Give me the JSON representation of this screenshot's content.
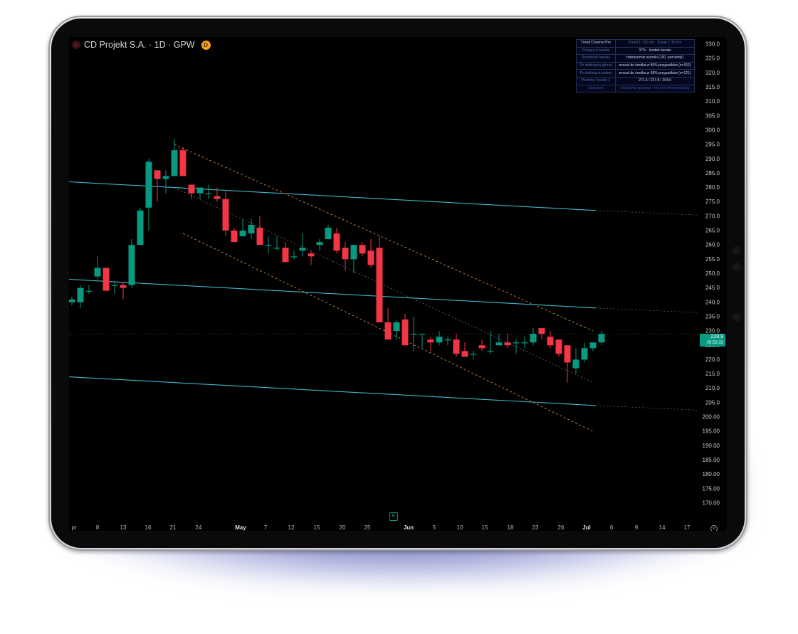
{
  "symbol": {
    "title": "CD Projekt S.A. · 1D · GPW",
    "badge": "D",
    "logo_glyph": "r"
  },
  "info_table": {
    "rows": [
      {
        "k": "Trend Channel Pro",
        "v": "Kanał 1: 100 dni · Kanał 2: 50 dni"
      },
      {
        "k": "Pozycja w kanale",
        "v": "37% · środek kanału"
      },
      {
        "k": "Szerokość kanału",
        "v": "historycznie szeroki (100. percentyl)"
      },
      {
        "k": "Po dotknięciu górnej",
        "v": "wracał do środka w 80% przypadków (n=152)"
      },
      {
        "k": "Po dotknięciu dolnej",
        "v": "wracał do środka w 58% przypadków (n=121)"
      },
      {
        "k": "Poziomy Kanału 1",
        "v": "271.6 / 237.8 / 204.0"
      },
      {
        "k": "Statystyki",
        "v": "statystyka opisowa – nie jest rekomendacją"
      }
    ]
  },
  "price_scale": {
    "labels": [
      "330.0",
      "325.0",
      "320.0",
      "315.0",
      "310.0",
      "305.0",
      "300.0",
      "295.0",
      "290.0",
      "285.0",
      "280.0",
      "275.0",
      "270.0",
      "265.0",
      "260.0",
      "255.0",
      "250.0",
      "245.0",
      "240.0",
      "235.0",
      "230.0",
      "225.0",
      "220.0",
      "215.0",
      "210.0",
      "205.0",
      "200.00",
      "195.00",
      "190.00",
      "185.00",
      "180.00",
      "175.00",
      "170.00"
    ],
    "current_price": "228.9",
    "countdown": "05:53:33"
  },
  "time_axis": {
    "labels": [
      "pr",
      "8",
      "13",
      "16",
      "21",
      "24",
      "May",
      "7",
      "12",
      "15",
      "20",
      "25",
      "Jun",
      "5",
      "10",
      "15",
      "18",
      "23",
      "26",
      "Jul",
      "6",
      "9",
      "14",
      "17"
    ]
  },
  "colors": {
    "up": "#089981",
    "down": "#f23645",
    "channel_cyan": "#3fb6c8",
    "channel_orange": "#d98a3a",
    "grid_dot": "#4a4a4a"
  },
  "chart_data": {
    "type": "candlestick",
    "interval": "1D",
    "ylim": [
      168,
      331
    ],
    "x": [
      "Apr 3",
      "Apr 4",
      "Apr 7",
      "Apr 8",
      "Apr 9",
      "Apr 10",
      "Apr 11",
      "Apr 14",
      "Apr 15",
      "Apr 16",
      "Apr 17",
      "Apr 18",
      "Apr 22",
      "Apr 23",
      "Apr 24",
      "Apr 25",
      "Apr 28",
      "Apr 29",
      "Apr 30",
      "May 2",
      "May 5",
      "May 6",
      "May 7",
      "May 8",
      "May 9",
      "May 12",
      "May 13",
      "May 14",
      "May 15",
      "May 16",
      "May 19",
      "May 20",
      "May 21",
      "May 22",
      "May 23",
      "May 26",
      "May 27",
      "May 28",
      "May 29",
      "May 30",
      "Jun 2",
      "Jun 3",
      "Jun 4",
      "Jun 5",
      "Jun 6",
      "Jun 9",
      "Jun 10",
      "Jun 11",
      "Jun 12",
      "Jun 13",
      "Jun 16",
      "Jun 17",
      "Jun 18",
      "Jun 19",
      "Jun 20",
      "Jun 23",
      "Jun 24",
      "Jun 25",
      "Jun 26",
      "Jun 27",
      "Jun 30",
      "Jul 1",
      "Jul 2"
    ],
    "ohlc": [
      [
        240,
        242,
        239,
        241
      ],
      [
        240,
        246,
        238,
        245
      ],
      [
        244,
        246,
        243,
        244
      ],
      [
        249,
        256,
        248,
        252
      ],
      [
        252,
        252,
        244,
        244
      ],
      [
        246,
        247,
        243,
        246
      ],
      [
        246,
        247,
        241,
        245
      ],
      [
        246,
        262,
        245,
        260
      ],
      [
        260,
        273,
        260,
        272
      ],
      [
        273,
        290,
        265,
        289
      ],
      [
        286,
        286,
        275,
        283
      ],
      [
        283,
        286,
        278,
        284
      ],
      [
        284,
        297,
        284,
        293
      ],
      [
        293,
        294,
        284,
        284
      ],
      [
        281,
        281,
        276,
        278
      ],
      [
        278,
        280,
        276,
        280
      ],
      [
        278,
        281,
        276,
        278
      ],
      [
        277,
        280,
        275,
        276
      ],
      [
        276,
        279,
        263,
        265
      ],
      [
        265,
        266,
        261,
        261
      ],
      [
        263,
        269,
        263,
        265
      ],
      [
        264,
        269,
        262,
        267
      ],
      [
        266,
        270,
        260,
        260
      ],
      [
        260,
        263,
        257,
        260
      ],
      [
        259,
        263,
        258,
        259
      ],
      [
        259,
        261,
        254,
        254
      ],
      [
        256,
        258,
        255,
        256
      ],
      [
        258,
        264,
        256,
        259
      ],
      [
        257,
        258,
        253,
        256
      ],
      [
        260,
        262,
        258,
        261
      ],
      [
        262,
        267,
        262,
        266
      ],
      [
        264,
        266,
        257,
        258
      ],
      [
        259,
        261,
        251,
        255
      ],
      [
        255,
        260,
        250,
        260
      ],
      [
        260,
        261,
        256,
        257
      ],
      [
        258,
        262,
        252,
        253
      ],
      [
        259,
        263,
        233,
        233
      ],
      [
        233,
        238,
        227,
        227
      ],
      [
        230,
        234,
        227,
        233
      ],
      [
        234,
        236,
        225,
        225
      ],
      [
        229,
        235,
        223,
        229
      ],
      [
        229,
        229,
        224,
        229
      ],
      [
        227,
        228,
        223,
        226
      ],
      [
        226,
        230,
        225,
        228
      ],
      [
        227,
        228,
        225,
        227
      ],
      [
        227,
        229,
        221,
        222
      ],
      [
        223,
        226,
        221,
        221
      ],
      [
        222,
        223,
        220,
        222
      ],
      [
        225,
        227,
        223,
        224
      ],
      [
        223,
        230,
        222,
        223
      ],
      [
        225,
        229,
        225,
        226
      ],
      [
        226,
        229,
        224,
        225
      ],
      [
        226,
        227,
        222,
        226
      ],
      [
        226,
        228,
        224,
        226
      ],
      [
        226,
        231,
        225,
        229
      ],
      [
        231,
        231,
        227,
        229
      ],
      [
        228,
        230,
        224,
        225
      ],
      [
        227,
        227,
        221,
        222
      ],
      [
        225,
        225,
        212,
        219
      ],
      [
        217,
        224,
        215,
        220
      ],
      [
        220,
        226,
        219,
        224
      ],
      [
        224,
        226,
        223,
        226
      ],
      [
        226,
        230,
        225,
        229
      ]
    ],
    "channel_1": {
      "upper": [
        282,
        272
      ],
      "middle": [
        248,
        238
      ],
      "lower": [
        214,
        204
      ],
      "levels": "271.6 / 237.8 / 204.0"
    },
    "channel_2": {
      "upper": [
        295,
        230
      ],
      "middle": [
        280,
        212
      ],
      "lower": [
        264,
        195
      ]
    },
    "last_price": 228.9
  }
}
